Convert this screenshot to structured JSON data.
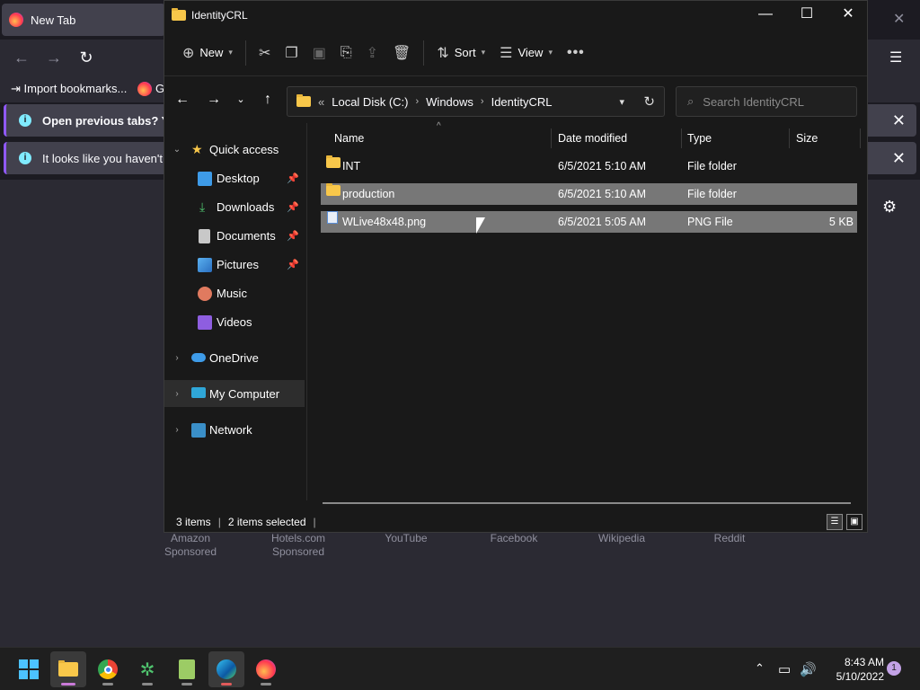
{
  "firefox": {
    "tab_title": "New Tab",
    "bookmarks": [
      "Import bookmarks...",
      "Ge"
    ],
    "notices": [
      "Open previous tabs? You c",
      "It looks like you haven't st"
    ],
    "shortcuts": [
      {
        "name": "Amazon",
        "sub": "Sponsored"
      },
      {
        "name": "Hotels.com",
        "sub": "Sponsored"
      },
      {
        "name": "YouTube",
        "sub": ""
      },
      {
        "name": "Facebook",
        "sub": ""
      },
      {
        "name": "Wikipedia",
        "sub": ""
      },
      {
        "name": "Reddit",
        "sub": ""
      }
    ]
  },
  "explorer": {
    "title": "IdentityCRL",
    "commands": {
      "new": "New",
      "sort": "Sort",
      "view": "View"
    },
    "address": {
      "overflow": "«",
      "crumbs": [
        "Local Disk (C:)",
        "Windows",
        "IdentityCRL"
      ]
    },
    "search_placeholder": "Search IdentityCRL",
    "nav": [
      {
        "label": "Quick access",
        "icon": "star-icon"
      },
      {
        "label": "Desktop",
        "icon": "desktop-icon"
      },
      {
        "label": "Downloads",
        "icon": "download-icon"
      },
      {
        "label": "Documents",
        "icon": "document-icon"
      },
      {
        "label": "Pictures",
        "icon": "picture-icon"
      },
      {
        "label": "Music",
        "icon": "music-icon"
      },
      {
        "label": "Videos",
        "icon": "video-icon"
      },
      {
        "label": "OneDrive",
        "icon": "cloud-icon"
      },
      {
        "label": "My Computer",
        "icon": "computer-icon"
      },
      {
        "label": "Network",
        "icon": "network-icon"
      }
    ],
    "columns": [
      "Name",
      "Date modified",
      "Type",
      "Size"
    ],
    "files": [
      {
        "name": "INT",
        "date": "6/5/2021 5:10 AM",
        "type": "File folder",
        "size": "",
        "selected": false
      },
      {
        "name": "production",
        "date": "6/5/2021 5:10 AM",
        "type": "File folder",
        "size": "",
        "selected": true
      },
      {
        "name": "WLive48x48.png",
        "date": "6/5/2021 5:05 AM",
        "type": "PNG File",
        "size": "5 KB",
        "selected": true
      }
    ],
    "status": {
      "items": "3 items",
      "selected": "2 items selected"
    }
  },
  "taskbar": {
    "time": "8:43 AM",
    "date": "5/10/2022",
    "notification_count": "1"
  },
  "colors": {
    "folder": "#f8c74a",
    "selection": "#777777",
    "accent": "#c97ad8"
  }
}
